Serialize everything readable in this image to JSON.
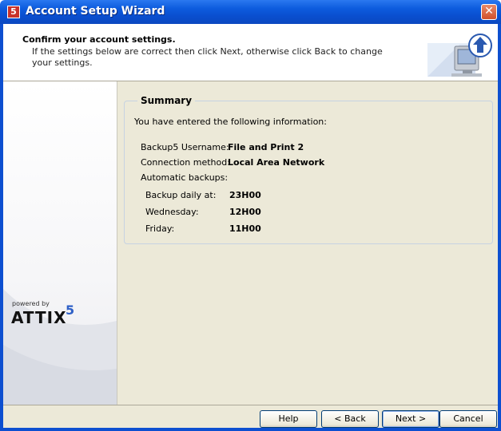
{
  "window": {
    "title": "Account Setup Wizard",
    "title_icon": "5",
    "close_glyph": "✕"
  },
  "header": {
    "title": "Confirm your account settings.",
    "subtitle": "If the settings below are correct then click Next, otherwise click Back to change your settings."
  },
  "side_panel": {
    "powered_by": "powered by",
    "brand": "ATTIX",
    "brand_superscript": "5"
  },
  "summary": {
    "legend": "Summary",
    "intro": "You have entered the following information:",
    "rows": [
      {
        "label": "Backup5 Username:",
        "value": "File and Print 2"
      },
      {
        "label": "Connection method:",
        "value": "Local Area Network"
      },
      {
        "label": "Automatic backups:",
        "value": ""
      },
      {
        "label": "Backup daily at:",
        "value": "23H00"
      },
      {
        "label": "Wednesday:",
        "value": "12H00"
      },
      {
        "label": "Friday:",
        "value": "11H00"
      }
    ]
  },
  "buttons": {
    "help": "Help",
    "back": "< Back",
    "next": "Next >",
    "cancel": "Cancel"
  },
  "colors": {
    "titlebar": "#0a4fd0",
    "dialog_bg": "#ece9d8",
    "accent": "#2f61c7"
  }
}
